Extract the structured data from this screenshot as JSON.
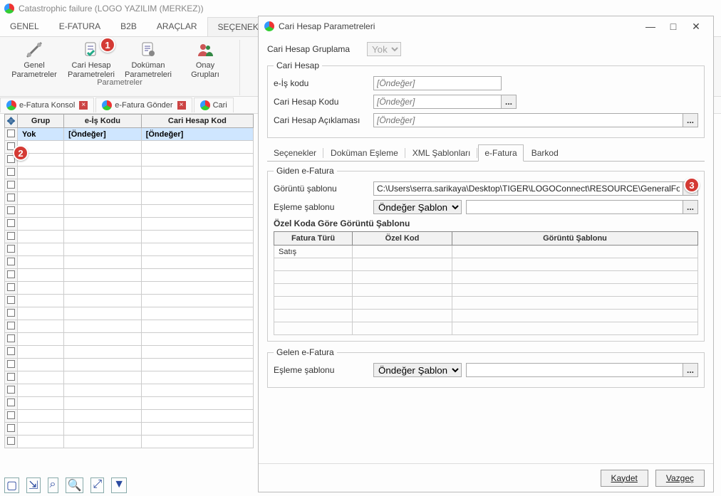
{
  "window": {
    "title": "Catastrophic failure (LOGO YAZILIM (MERKEZ))"
  },
  "menu": {
    "items": [
      "GENEL",
      "E-FATURA",
      "B2B",
      "ARAÇLAR",
      "SEÇENEK"
    ],
    "active_index": 4
  },
  "ribbon": {
    "group_label": "Parametreler",
    "buttons": {
      "genel": {
        "line1": "Genel",
        "line2": "Parametreler"
      },
      "cari": {
        "line1": "Cari Hesap",
        "line2": "Parametreleri"
      },
      "dokuman": {
        "line1": "Doküman",
        "line2": "Parametreleri"
      },
      "onay": {
        "line1": "Onay",
        "line2": "Grupları"
      }
    }
  },
  "badges": {
    "b1": "1",
    "b2": "2",
    "b3": "3"
  },
  "doctabs": {
    "t1": "e-Fatura Konsol",
    "t2": "e-Fatura Gönder",
    "t3": "Cari"
  },
  "grid": {
    "corner_glyph": "✥",
    "headers": {
      "grup": "Grup",
      "eis": "e-İş Kodu",
      "cari": "Cari Hesap Kod"
    },
    "row1": {
      "grup": "Yok",
      "eis": "[Öndeğer]",
      "cari": "[Öndeğer]"
    }
  },
  "dialog": {
    "title": "Cari Hesap Parametreleri",
    "gruplama_label": "Cari Hesap Gruplama",
    "gruplama_value": "Yok",
    "fs_cari": "Cari Hesap",
    "eis_label": "e-İş kodu",
    "kod_label": "Cari Hesap Kodu",
    "acik_label": "Cari Hesap Açıklaması",
    "ph_ondeger": "[Öndeğer]",
    "tabs": [
      "Seçenekler",
      "Doküman Eşleme",
      "XML Şablonları",
      "e-Fatura",
      "Barkod"
    ],
    "tabs_active": 3,
    "giden_legend": "Giden e-Fatura",
    "goruntu_label": "Görüntü şablonu",
    "goruntu_value": "C:\\Users\\serra.sarikaya\\Desktop\\TIGER\\LOGOConnect\\RESOURCE\\GeneralFor",
    "esleme_label": "Eşleme şablonu",
    "esleme_value": "Öndeğer Şablon",
    "ozel_kod_title": "Özel Koda Göre Görüntü Şablonu",
    "inner_headers": {
      "tur": "Fatura Türü",
      "kod": "Özel Kod",
      "sablon": "Görüntü Şablonu"
    },
    "inner_row1": {
      "tur": "Satış",
      "kod": "",
      "sablon": ""
    },
    "gelen_legend": "Gelen e-Fatura",
    "gelen_esleme_value": "Öndeğer Şablon",
    "btn_save": "Kaydet",
    "btn_cancel": "Vazgeç"
  },
  "icons": {
    "minimize": "—",
    "maximize": "□",
    "close": "✕",
    "dots": "...",
    "dropdown": "▼"
  }
}
